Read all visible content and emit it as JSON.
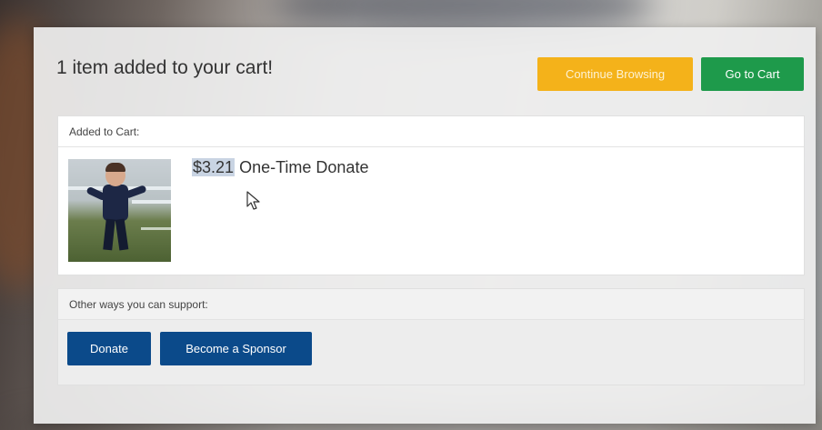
{
  "modal": {
    "title": "1 item added to your cart!",
    "continue_label": "Continue Browsing",
    "go_to_cart_label": "Go to Cart"
  },
  "cart_panel": {
    "heading": "Added to Cart:",
    "item": {
      "price": "$3.21",
      "name": "One-Time Donate"
    }
  },
  "support_panel": {
    "heading": "Other ways you can support:",
    "donate_label": "Donate",
    "sponsor_label": "Become a Sponsor"
  },
  "colors": {
    "continue": "#f4b21a",
    "go_to_cart": "#1e9a4b",
    "primary": "#0b4a8a"
  },
  "icons": {
    "cursor": "mouse-pointer-icon"
  }
}
